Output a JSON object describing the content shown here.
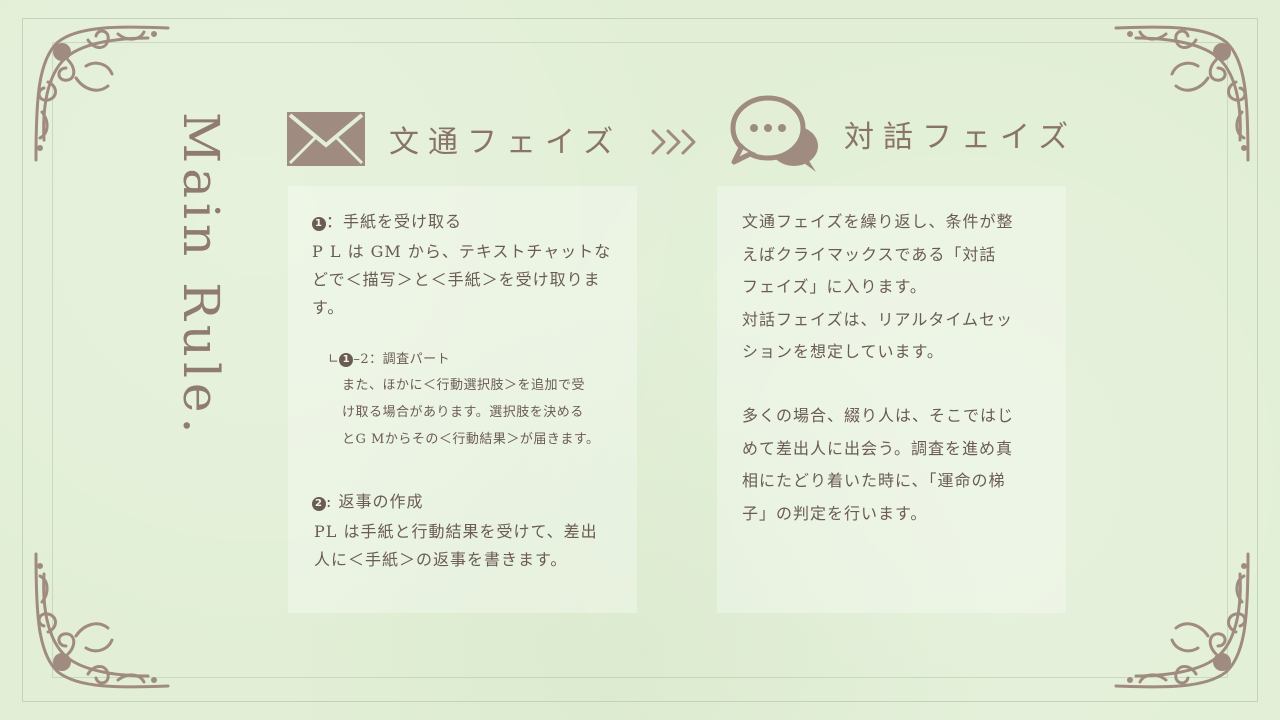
{
  "side_title": "Main Rule.",
  "phase1": {
    "label": "文通フェイズ",
    "icon": "envelope-icon"
  },
  "arrow_icon": "triple-chevron-right-icon",
  "phase2": {
    "label": "対話フェイズ",
    "icon": "speech-bubble-icon"
  },
  "left_panel": {
    "step1_num": "1",
    "step1_title": "：手紙を受け取る",
    "step1_body_lines": [
      "P L は GM から、テキストチャットな",
      "どで＜描写＞と＜手紙＞を受け取りま",
      "す。"
    ],
    "sub_prefix": "∟",
    "sub_num": "1",
    "sub_title": "–2：調査パート",
    "sub_body_lines": [
      "また、ほかに＜行動選択肢＞を追加で受",
      "け取る場合があります。選択肢を決める",
      "とG Mからその＜行動結果＞が届きます。"
    ],
    "step2_num": "2",
    "step2_title": ": 返事の作成",
    "step2_body_lines": [
      "PL は手紙と行動結果を受けて、差出",
      "人に＜手紙＞の返事を書きます。"
    ]
  },
  "right_panel": {
    "para1_lines": [
      "文通フェイズを繰り返し、条件が整",
      "えばクライマックスである「対話",
      "フェイズ」に入ります。",
      "対話フェイズは、リアルタイムセッ",
      "ションを想定しています。"
    ],
    "para2_lines": [
      "多くの場合、綴り人は、そこではじ",
      "めて差出人に出会う。調査を進め真",
      "相にたどり着いた時に、「運命の梯",
      "子」の判定を行います。"
    ]
  },
  "colors": {
    "background": "#e2efd6",
    "ornament": "#a08b80",
    "text": "#6b5c52",
    "heading": "#8a7469"
  }
}
